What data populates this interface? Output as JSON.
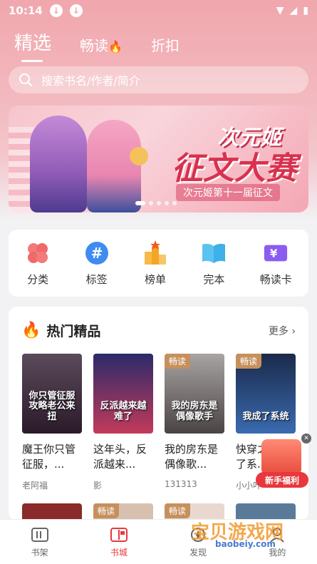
{
  "status_bar": {
    "time": "10:14"
  },
  "tabs": [
    {
      "label": "精选",
      "active": true
    },
    {
      "label": "畅读",
      "active": false
    },
    {
      "label": "折扣",
      "active": false
    }
  ],
  "search": {
    "placeholder": "搜索书名/作者/简介"
  },
  "banner": {
    "title_line1": "次元姬",
    "title_line2": "征文大赛",
    "subtitle": "次元姬第十一届征文",
    "slide_count": 5,
    "active_slide": 0
  },
  "categories": [
    {
      "label": "分类",
      "icon": "clover-icon",
      "color": "#f06a6a"
    },
    {
      "label": "标签",
      "icon": "hashtag-icon",
      "color": "#3f8cf0"
    },
    {
      "label": "榜单",
      "icon": "podium-icon",
      "color": "#f5a623"
    },
    {
      "label": "完本",
      "icon": "open-book-icon",
      "color": "#3fb0e8"
    },
    {
      "label": "畅读卡",
      "icon": "yen-card-icon",
      "color": "#8a5cf0"
    }
  ],
  "hot": {
    "title": "热门精品",
    "more": "更多",
    "books": [
      {
        "title": "魔王你只管征服，...",
        "author": "老阿福",
        "tag": "",
        "cover_text": "你只管征服 攻略老公来扭",
        "cover_color": "#3a2a3a"
      },
      {
        "title": "这年头，反派越来...",
        "author": "影",
        "tag": "",
        "cover_text": "反派越来越难了",
        "cover_color": "#2f2a5a"
      },
      {
        "title": "我的房东是偶像歌...",
        "author": "131313",
        "tag": "畅读",
        "cover_text": "我的房东是偶像歌手",
        "cover_color": "#7a7070"
      },
      {
        "title": "快穿之我成了系...",
        "author": "小小叶",
        "tag": "畅读",
        "cover_text": "我成了系统",
        "cover_color": "#1a2a5a"
      }
    ]
  },
  "row2_tags": [
    "",
    "畅读",
    "畅读",
    ""
  ],
  "newbie": {
    "label": "新手福利"
  },
  "bottom_nav": [
    {
      "label": "书架",
      "active": false
    },
    {
      "label": "书城",
      "active": true
    },
    {
      "label": "发现",
      "active": false
    },
    {
      "label": "我的",
      "active": false
    }
  ],
  "watermark": {
    "text": "宝贝游戏网",
    "url": "baobeiy.com"
  }
}
